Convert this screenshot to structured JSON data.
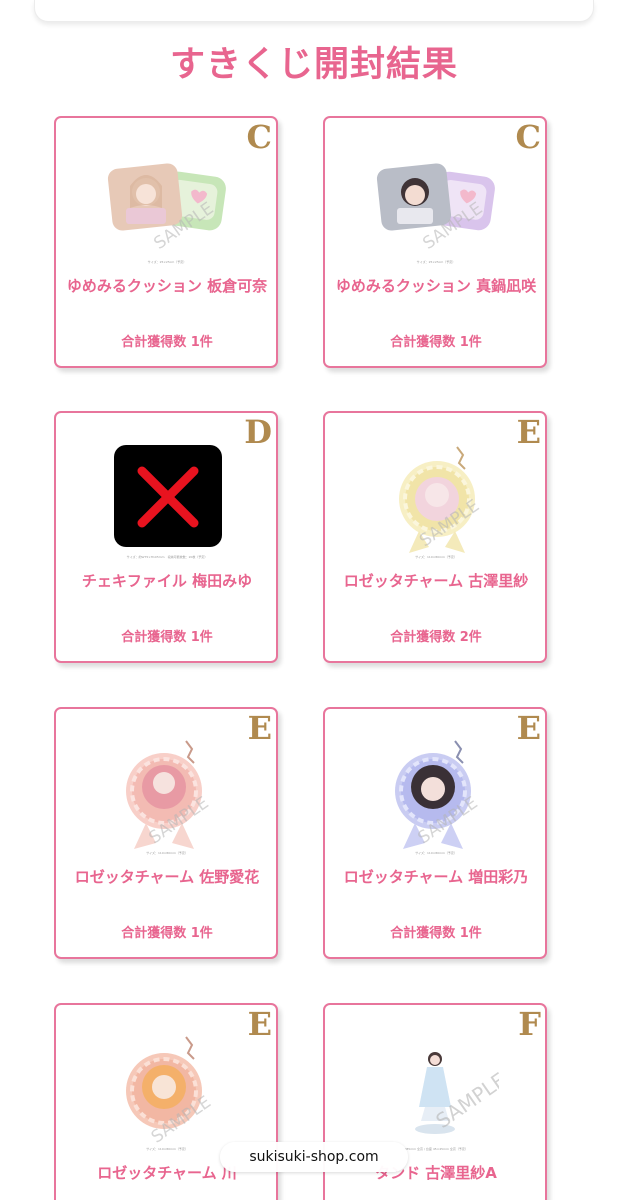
{
  "page": {
    "title": "すきくじ開封結果",
    "watermark": "sukisuki-shop.com"
  },
  "cards": [
    {
      "rank": "C",
      "name": "ゆめみるクッション 板倉可奈",
      "count": "合計獲得数 1件",
      "thumb": "cushion-green-icon",
      "caption": "サイズ：25×25cm（予定）"
    },
    {
      "rank": "C",
      "name": "ゆめみるクッション 真鍋凪咲",
      "count": "合計獲得数 1件",
      "thumb": "cushion-purple-icon",
      "caption": "サイズ：25×25cm（予定）"
    },
    {
      "rank": "D",
      "name": "チェキファイル 梅田みゆ",
      "count": "合計獲得数 1件",
      "thumb": "broken-image-icon",
      "caption": "サイズ：約W75×H105mm　収納可能枚数：20枚（予定）"
    },
    {
      "rank": "E",
      "name": "ロゼッタチャーム 古澤里紗",
      "count": "合計獲得数 2件",
      "thumb": "rosette-yellow-icon",
      "caption": "サイズ：110×80mm（予定）"
    },
    {
      "rank": "E",
      "name": "ロゼッタチャーム 佐野愛花",
      "count": "合計獲得数 1件",
      "thumb": "rosette-pink-icon",
      "caption": "サイズ：110×80mm（予定）"
    },
    {
      "rank": "E",
      "name": "ロゼッタチャーム 増田彩乃",
      "count": "合計獲得数 1件",
      "thumb": "rosette-blue-icon",
      "caption": "サイズ：110×80mm（予定）"
    },
    {
      "rank": "E",
      "name": "ロゼッタチャーム 川",
      "count": "",
      "thumb": "rosette-peach-icon",
      "caption": "サイズ：110×80mm（予定）"
    },
    {
      "rank": "F",
      "name": "タンド 古澤里紗A",
      "count": "",
      "thumb": "acrylic-stand-icon",
      "caption": "H85mm 全高 / 台座 45×45mm 全高（予定）"
    }
  ],
  "sample_label": "SAMPLE",
  "colors": {
    "accent": "#e8658f",
    "border": "#e8759c",
    "rank": "#b08a4f"
  }
}
